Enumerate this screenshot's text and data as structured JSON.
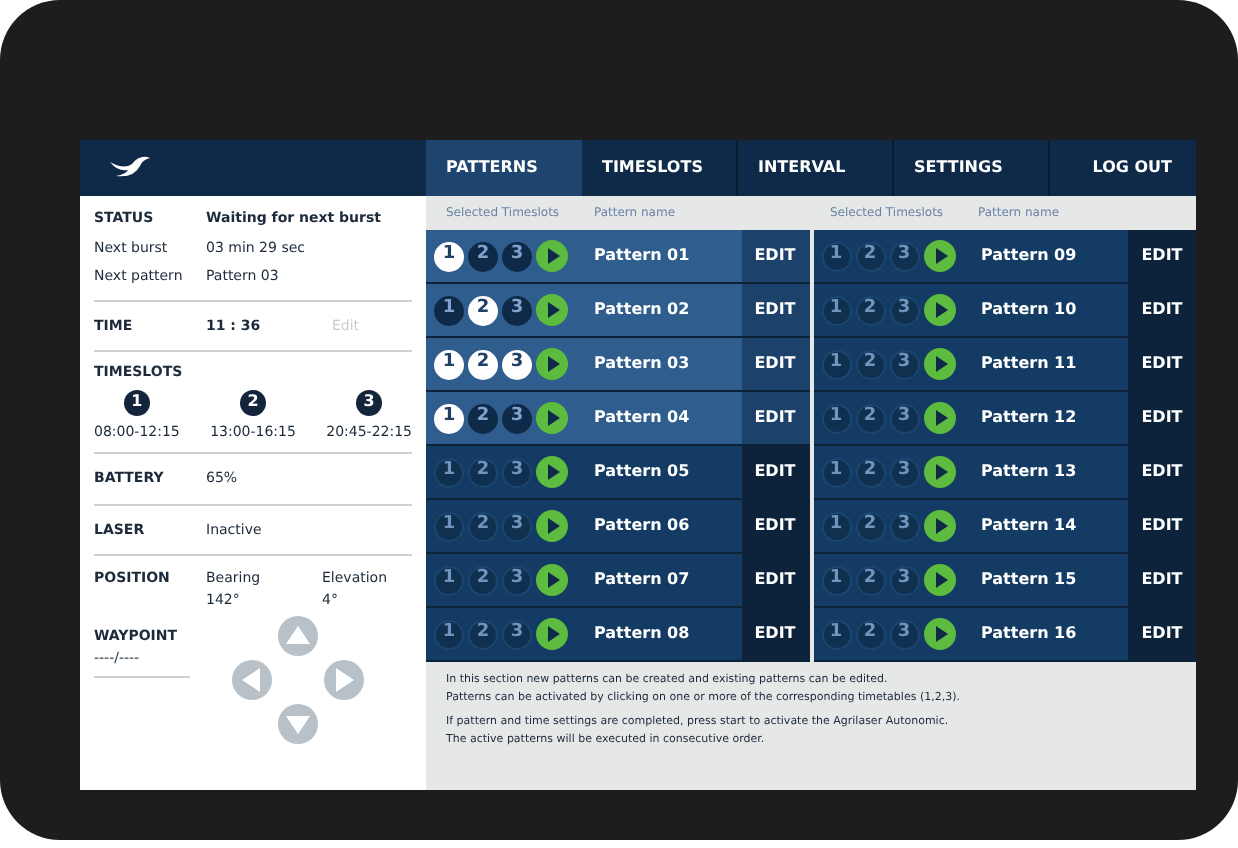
{
  "nav": {
    "tabs": [
      {
        "label": "PATTERNS",
        "selected": true
      },
      {
        "label": "TIMESLOTS",
        "selected": false
      },
      {
        "label": "INTERVAL",
        "selected": false
      },
      {
        "label": "SETTINGS",
        "selected": false
      }
    ],
    "logout": "LOG OUT"
  },
  "status": {
    "label": "STATUS",
    "value": "Waiting for next burst",
    "rows": [
      {
        "label": "Next burst",
        "value": "03 min 29 sec"
      },
      {
        "label": "Next pattern",
        "value": "Pattern 03"
      }
    ]
  },
  "time": {
    "label": "TIME",
    "value": "11 : 36",
    "edit": "Edit",
    "edit_disabled": true
  },
  "timeslots": {
    "label": "TIMESLOTS",
    "slots": [
      {
        "number": "1",
        "range": "08:00-12:15"
      },
      {
        "number": "2",
        "range": "13:00-16:15"
      },
      {
        "number": "3",
        "range": "20:45-22:15"
      }
    ]
  },
  "battery": {
    "label": "BATTERY",
    "value": "65%"
  },
  "laser": {
    "label": "LASER",
    "value": "Inactive"
  },
  "position": {
    "label": "POSITION",
    "bearing_label": "Bearing",
    "bearing": "142°",
    "elevation_label": "Elevation",
    "elevation": "4°"
  },
  "waypoint": {
    "label": "WAYPOINT",
    "value": "----/----"
  },
  "patterns": {
    "columns": [
      "Selected Timeslots",
      "Pattern name",
      "Selected Timeslots",
      "Pattern name"
    ],
    "items": [
      {
        "name": "Pattern 01",
        "edit": "EDIT",
        "slots": [
          {
            "number": "1",
            "selected": true
          },
          {
            "number": "2",
            "selected": false
          },
          {
            "number": "3",
            "selected": false
          }
        ]
      },
      {
        "name": "Pattern 02",
        "edit": "EDIT",
        "slots": [
          {
            "number": "1",
            "selected": false
          },
          {
            "number": "2",
            "selected": true
          },
          {
            "number": "3",
            "selected": false
          }
        ]
      },
      {
        "name": "Pattern 03",
        "edit": "EDIT",
        "slots": [
          {
            "number": "1",
            "selected": true
          },
          {
            "number": "2",
            "selected": true
          },
          {
            "number": "3",
            "selected": true
          }
        ]
      },
      {
        "name": "Pattern 04",
        "edit": "EDIT",
        "slots": [
          {
            "number": "1",
            "selected": true
          },
          {
            "number": "2",
            "selected": false
          },
          {
            "number": "3",
            "selected": false
          }
        ]
      },
      {
        "name": "Pattern 05",
        "edit": "EDIT",
        "slots": [
          {
            "number": "1",
            "selected": false
          },
          {
            "number": "2",
            "selected": false
          },
          {
            "number": "3",
            "selected": false
          }
        ]
      },
      {
        "name": "Pattern 06",
        "edit": "EDIT",
        "slots": [
          {
            "number": "1",
            "selected": false
          },
          {
            "number": "2",
            "selected": false
          },
          {
            "number": "3",
            "selected": false
          }
        ]
      },
      {
        "name": "Pattern 07",
        "edit": "EDIT",
        "slots": [
          {
            "number": "1",
            "selected": false
          },
          {
            "number": "2",
            "selected": false
          },
          {
            "number": "3",
            "selected": false
          }
        ]
      },
      {
        "name": "Pattern 08",
        "edit": "EDIT",
        "slots": [
          {
            "number": "1",
            "selected": false
          },
          {
            "number": "2",
            "selected": false
          },
          {
            "number": "3",
            "selected": false
          }
        ]
      },
      {
        "name": "Pattern 09",
        "edit": "EDIT",
        "slots": [
          {
            "number": "1",
            "selected": false
          },
          {
            "number": "2",
            "selected": false
          },
          {
            "number": "3",
            "selected": false
          }
        ]
      },
      {
        "name": "Pattern 10",
        "edit": "EDIT",
        "slots": [
          {
            "number": "1",
            "selected": false
          },
          {
            "number": "2",
            "selected": false
          },
          {
            "number": "3",
            "selected": false
          }
        ]
      },
      {
        "name": "Pattern 11",
        "edit": "EDIT",
        "slots": [
          {
            "number": "1",
            "selected": false
          },
          {
            "number": "2",
            "selected": false
          },
          {
            "number": "3",
            "selected": false
          }
        ]
      },
      {
        "name": "Pattern 12",
        "edit": "EDIT",
        "slots": [
          {
            "number": "1",
            "selected": false
          },
          {
            "number": "2",
            "selected": false
          },
          {
            "number": "3",
            "selected": false
          }
        ]
      },
      {
        "name": "Pattern 13",
        "edit": "EDIT",
        "slots": [
          {
            "number": "1",
            "selected": false
          },
          {
            "number": "2",
            "selected": false
          },
          {
            "number": "3",
            "selected": false
          }
        ]
      },
      {
        "name": "Pattern 14",
        "edit": "EDIT",
        "slots": [
          {
            "number": "1",
            "selected": false
          },
          {
            "number": "2",
            "selected": false
          },
          {
            "number": "3",
            "selected": false
          }
        ]
      },
      {
        "name": "Pattern 15",
        "edit": "EDIT",
        "slots": [
          {
            "number": "1",
            "selected": false
          },
          {
            "number": "2",
            "selected": false
          },
          {
            "number": "3",
            "selected": false
          }
        ]
      },
      {
        "name": "Pattern 16",
        "edit": "EDIT",
        "slots": [
          {
            "number": "1",
            "selected": false
          },
          {
            "number": "2",
            "selected": false
          },
          {
            "number": "3",
            "selected": false
          }
        ]
      }
    ]
  },
  "info": [
    "In this section new patterns can be created and existing patterns can be edited.",
    "Patterns can be activated by clicking on one or more of the corresponding timetables (1,2,3).",
    "If pattern and time settings are completed, press start to activate the Agrilaser Autonomic.",
    "The active patterns will be executed in consecutive order."
  ]
}
